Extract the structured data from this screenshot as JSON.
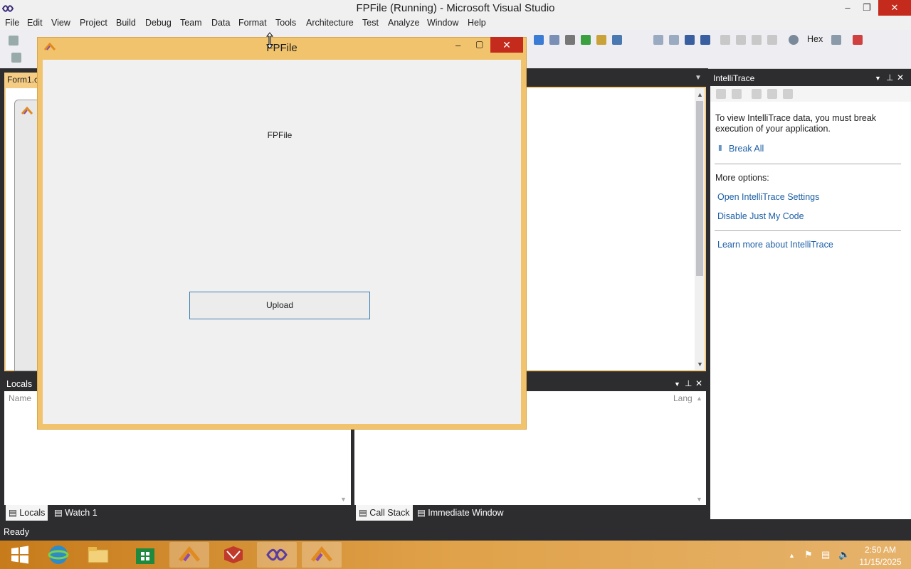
{
  "vs": {
    "title": "FPFile (Running) - Microsoft Visual Studio",
    "menu": [
      "File",
      "Edit",
      "View",
      "Project",
      "Build",
      "Debug",
      "Team",
      "Data",
      "Format",
      "Tools",
      "Architecture",
      "Test",
      "Analyze",
      "Window",
      "Help"
    ],
    "toolbar_hex": "Hex",
    "doc_tab": "Form1.c",
    "status": "Ready"
  },
  "intellitrace": {
    "title": "IntelliTrace",
    "message": "To view IntelliTrace data, you must break execution of your application.",
    "break_all": "Break All",
    "more_options": "More options:",
    "link_settings": "Open IntelliTrace Settings",
    "link_jmc": "Disable Just My Code",
    "link_learn": "Learn more about IntelliTrace"
  },
  "locals": {
    "title": "Locals",
    "col_name": "Name",
    "tab_locals": "Locals",
    "tab_watch": "Watch 1"
  },
  "callstack": {
    "col_lang": "Lang",
    "tab_callstack": "Call Stack",
    "tab_immediate": "Immediate Window"
  },
  "form": {
    "title": "FPFile",
    "label": "FPFile",
    "upload": "Upload"
  },
  "taskbar": {
    "time": "2:50 AM",
    "date": "11/15/2025"
  },
  "colors": {
    "accent": "#f0c36c",
    "close": "#c42b1c",
    "link": "#1c5fa6",
    "dark": "#2d2d30"
  }
}
